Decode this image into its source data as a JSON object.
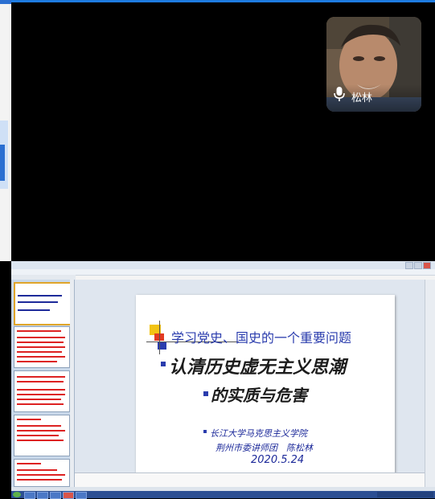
{
  "participant": {
    "name": "松林"
  },
  "slide": {
    "title_line1": "学习党史、国史的一个重要问题",
    "title_line2": "认清历史虚无主义思潮",
    "title_line3": "的实质与危害",
    "sub_line1": "长江大学马克思主义学院",
    "sub_line2": "荆州市委讲师团　陈松林",
    "date": "2020.5.24"
  },
  "colors": {
    "slide_accent_blue": "#2a3cad",
    "slide_yellow": "#f2c314",
    "slide_red": "#e23a22",
    "meeting_border_blue": "#1e7be0"
  }
}
